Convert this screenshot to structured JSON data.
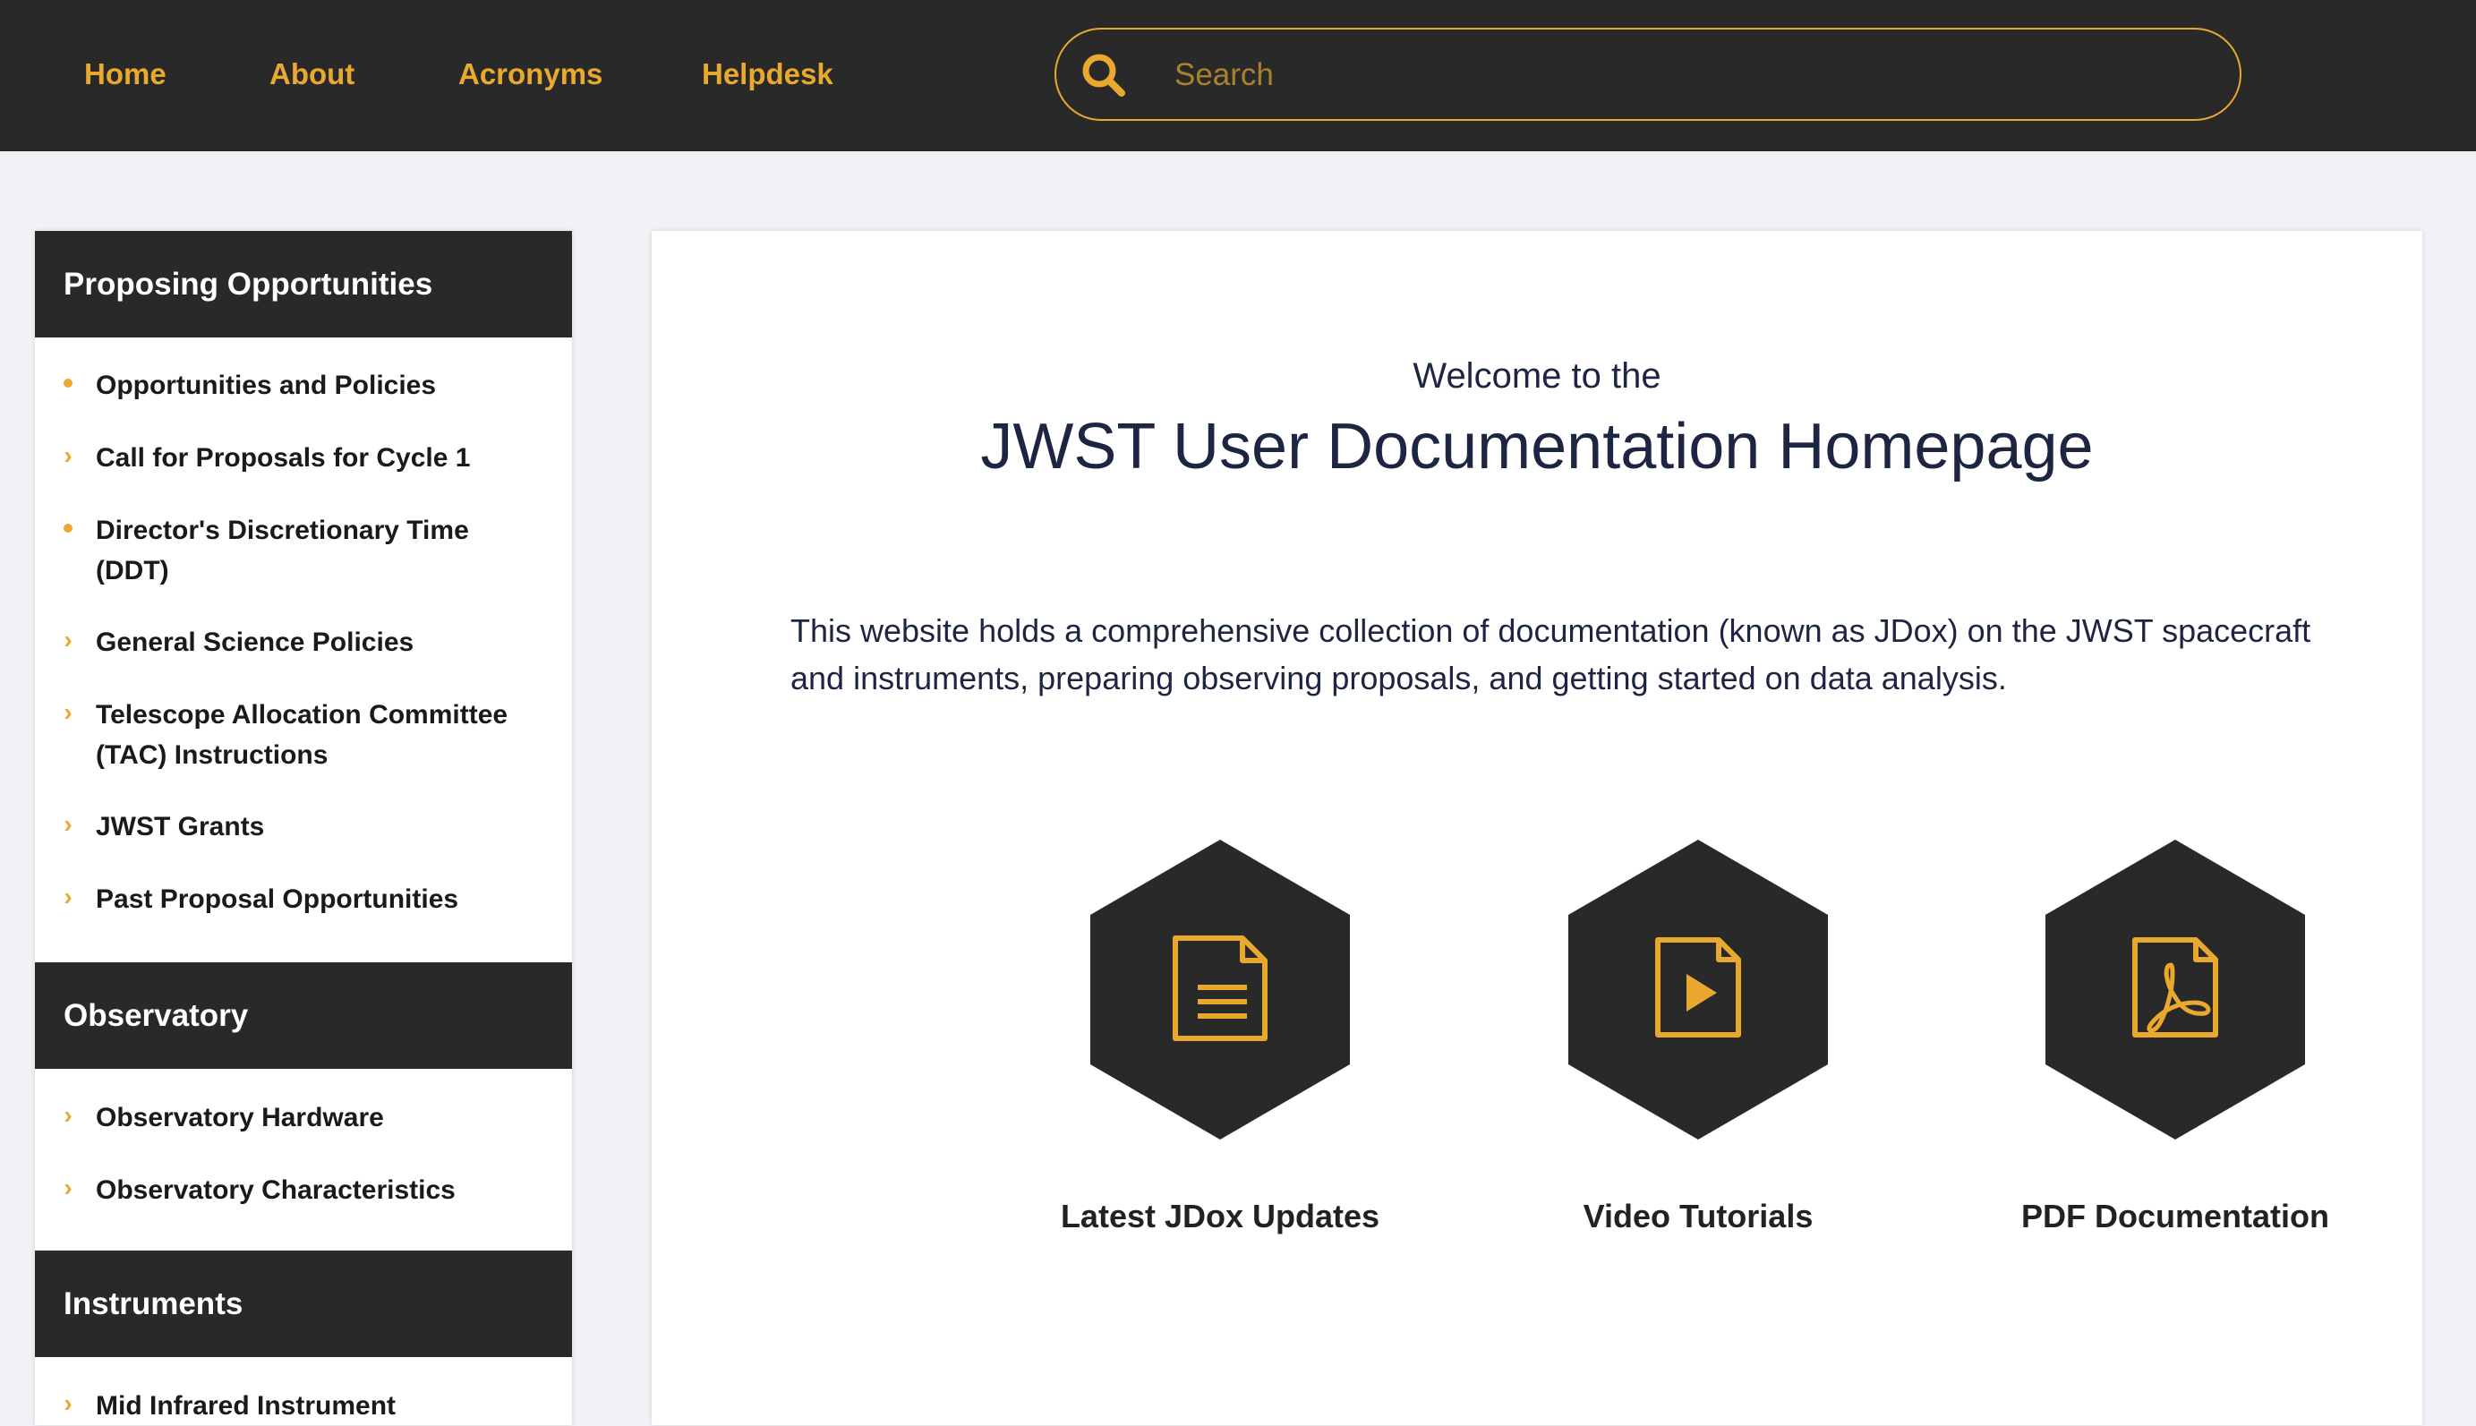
{
  "nav": {
    "links": [
      {
        "label": "Home"
      },
      {
        "label": "About"
      },
      {
        "label": "Acronyms"
      },
      {
        "label": "Helpdesk"
      }
    ],
    "search": {
      "placeholder": "Search",
      "value": ""
    }
  },
  "sidebar": {
    "sections": [
      {
        "title": "Proposing Opportunities",
        "items": [
          {
            "label": "Opportunities and Policies",
            "marker": "dot"
          },
          {
            "label": "Call for Proposals for Cycle 1",
            "marker": "chevron"
          },
          {
            "label": "Director's Discretionary Time (DDT)",
            "marker": "dot"
          },
          {
            "label": "General Science Policies",
            "marker": "chevron"
          },
          {
            "label": "Telescope Allocation Committee (TAC) Instructions",
            "marker": "chevron"
          },
          {
            "label": "JWST Grants",
            "marker": "chevron"
          },
          {
            "label": "Past Proposal Opportunities",
            "marker": "chevron"
          }
        ]
      },
      {
        "title": "Observatory",
        "items": [
          {
            "label": "Observatory Hardware",
            "marker": "chevron"
          },
          {
            "label": "Observatory Characteristics",
            "marker": "chevron"
          }
        ]
      },
      {
        "title": "Instruments",
        "items": [
          {
            "label": "Mid Infrared Instrument",
            "marker": "chevron"
          }
        ]
      }
    ]
  },
  "main": {
    "welcome": "Welcome to the",
    "title": "JWST User Documentation Homepage",
    "intro": "This website holds a comprehensive collection of documentation (known as JDox) on the JWST spacecraft and instruments, preparing observing proposals, and getting started on data analysis.",
    "tiles": [
      {
        "label": "Latest JDox Updates",
        "icon": "document-icon"
      },
      {
        "label": "Video Tutorials",
        "icon": "video-file-icon"
      },
      {
        "label": "PDF Documentation",
        "icon": "pdf-file-icon"
      }
    ]
  },
  "colors": {
    "dark": "#292929",
    "accent": "#e8a92e",
    "title_text": "#1c2541",
    "page_bg": "#f0f2f5"
  }
}
